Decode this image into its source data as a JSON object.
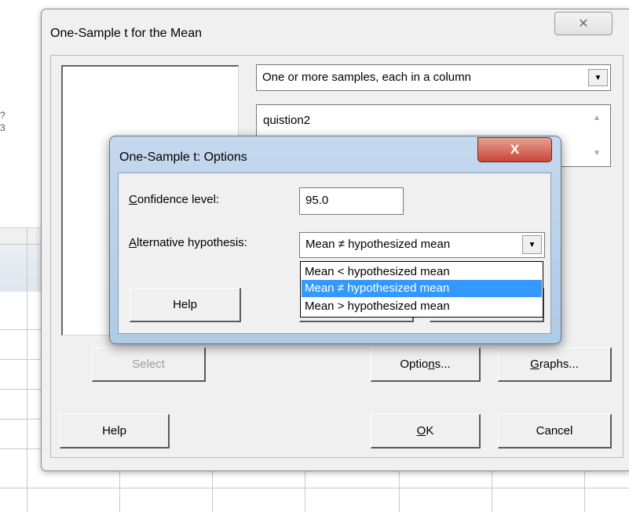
{
  "background": {
    "left_edge_chars": [
      "?",
      "3"
    ]
  },
  "main_dialog": {
    "title": "One-Sample t for the Mean",
    "close_glyph": "✕",
    "sample_mode": {
      "selected": "One or more samples, each in a column"
    },
    "samples_value": "quistion2",
    "buttons": {
      "select": "Select",
      "options": "Options...",
      "graphs": "Graphs...",
      "help": "Help",
      "ok": "OK",
      "cancel": "Cancel"
    }
  },
  "options_dialog": {
    "title": "One-Sample t: Options",
    "close_glyph": "X",
    "confidence_label": "Confidence level:",
    "confidence_value": "95.0",
    "alternative_label": "Alternative hypothesis:",
    "alternative_selected": "Mean ≠ hypothesized mean",
    "alternative_options": [
      "Mean < hypothesized mean",
      "Mean ≠ hypothesized mean",
      "Mean > hypothesized mean"
    ],
    "highlighted_index": 1,
    "help_label": "Help"
  },
  "colors": {
    "highlight": "#3399ff",
    "close_button": "#c7463a",
    "dialog_frame": "#aecbe6"
  }
}
